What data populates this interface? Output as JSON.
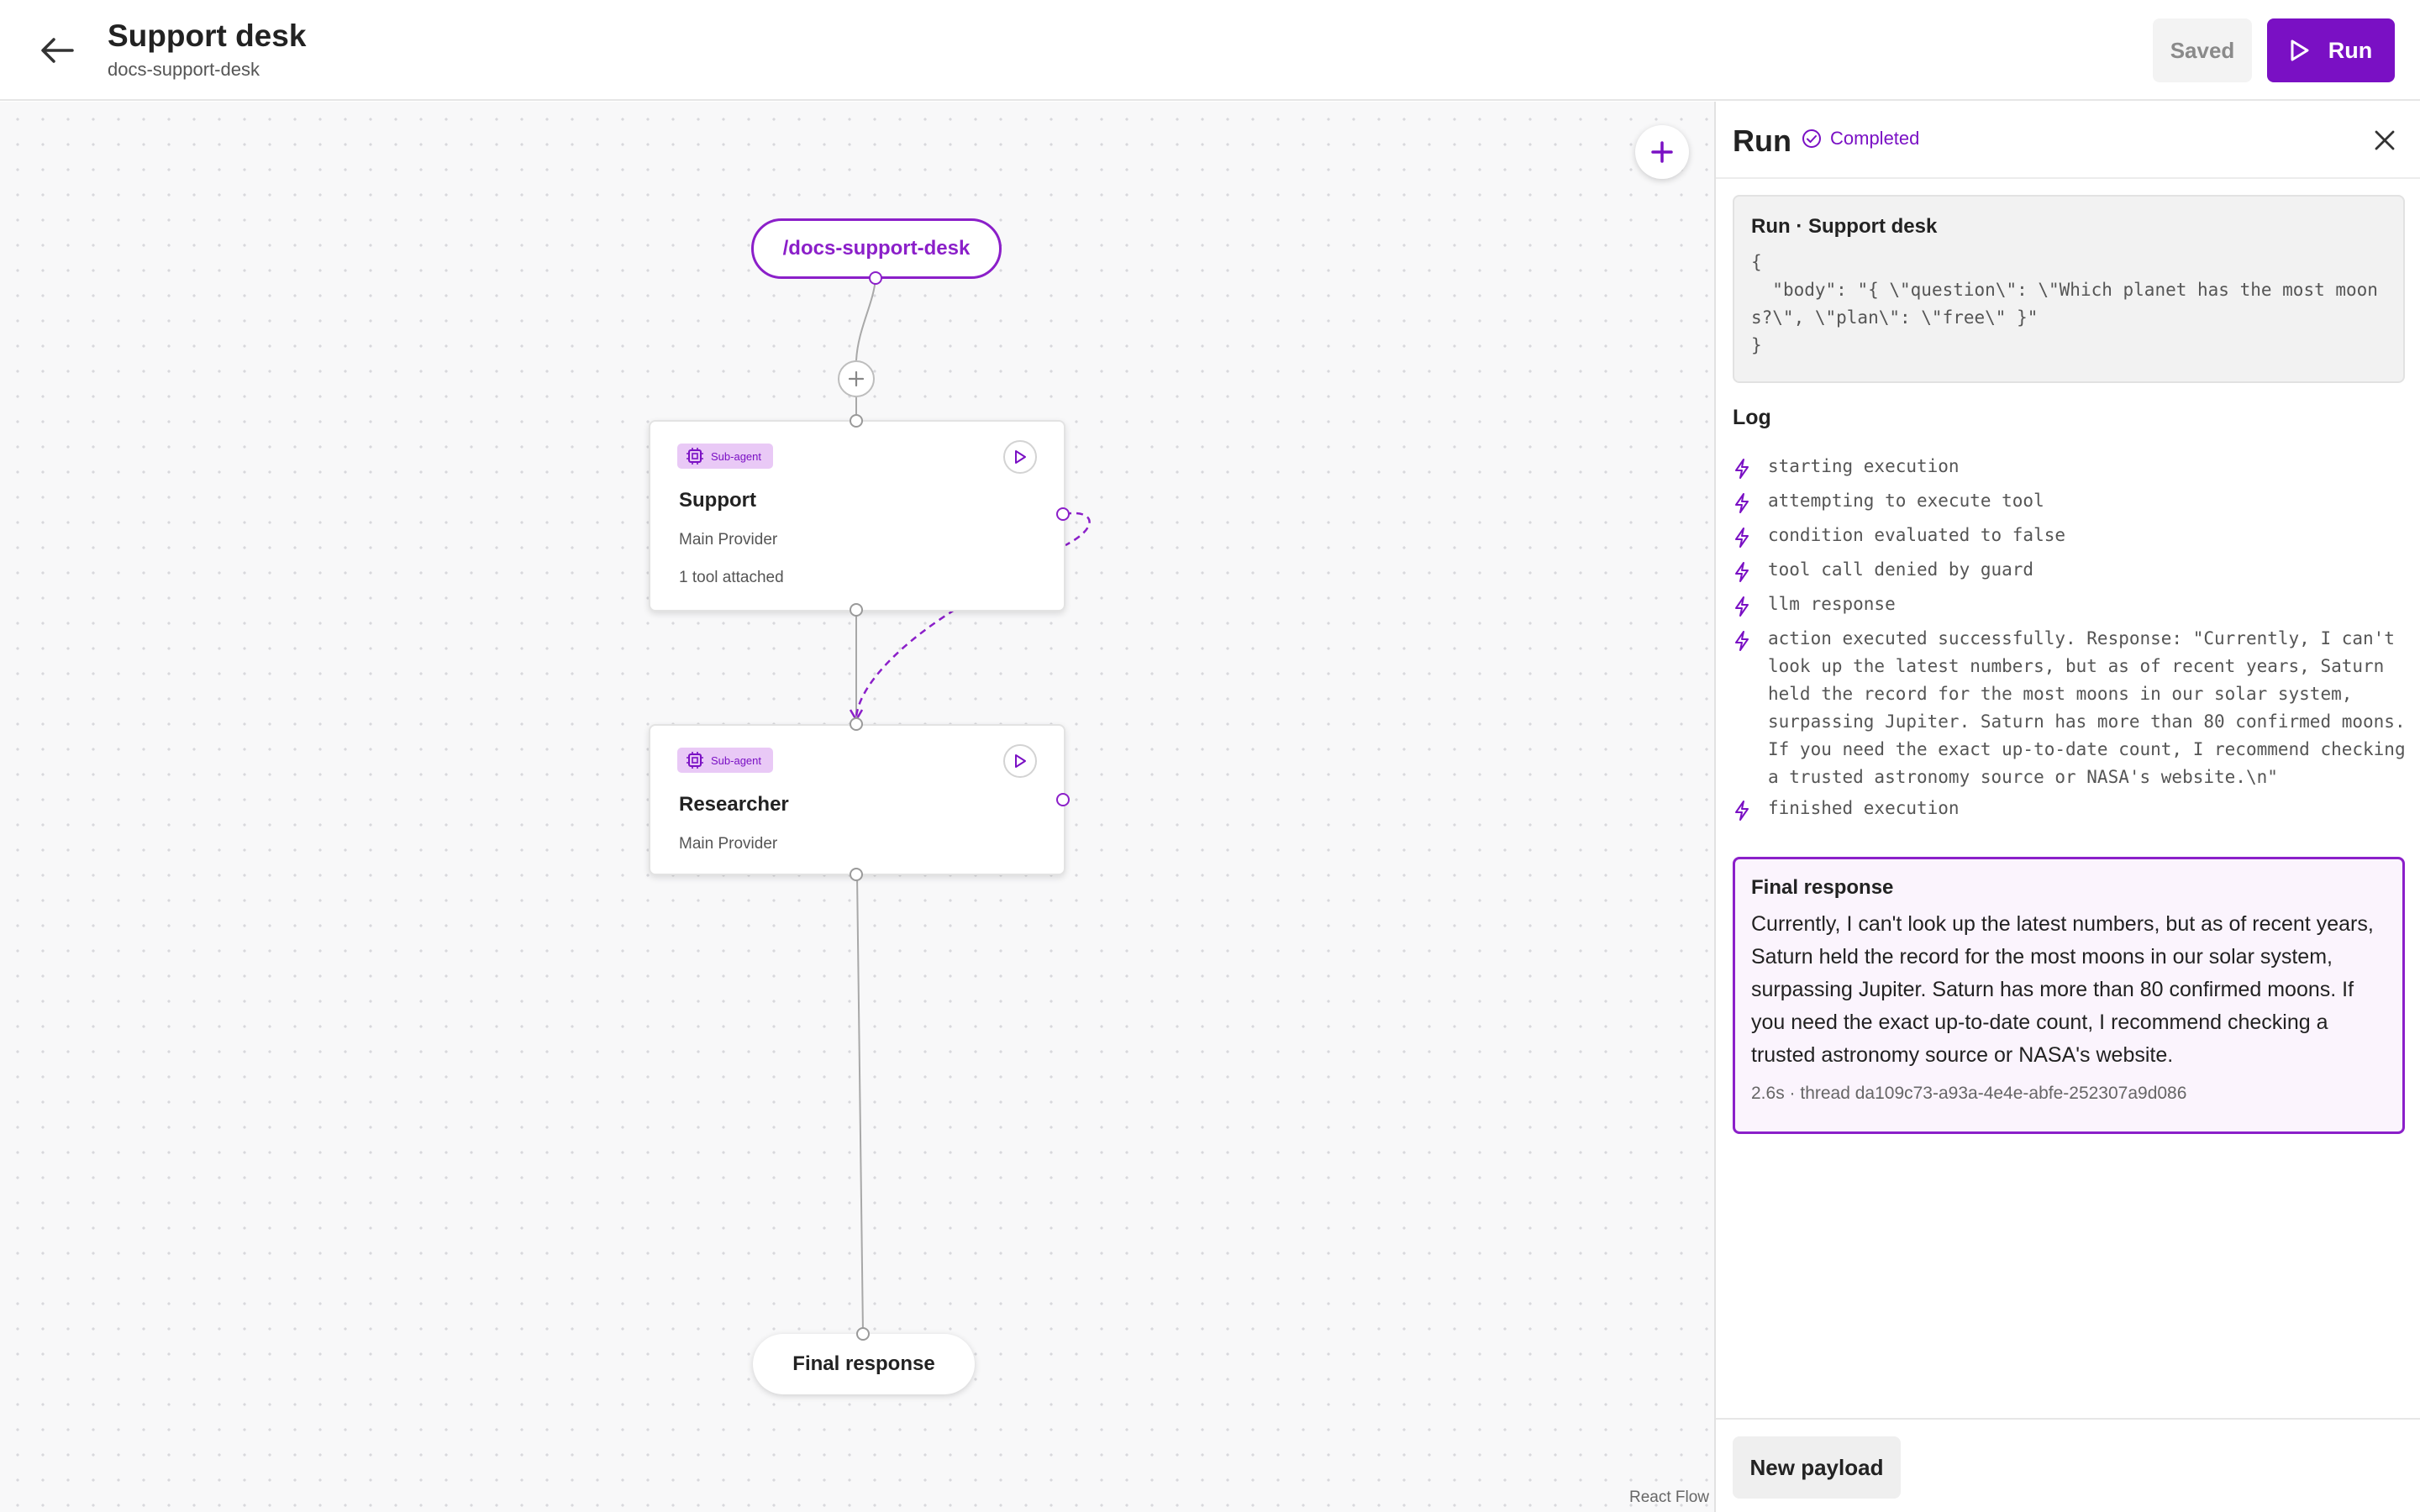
{
  "header": {
    "title": "Support desk",
    "subtitle": "docs-support-desk",
    "saved_label": "Saved",
    "run_label": "Run"
  },
  "colors": {
    "accent": "#7a10c4",
    "accent_light": "#e9c9f6",
    "canvas_bg": "#f8f8f9"
  },
  "canvas": {
    "trigger_label": "/docs-support-desk",
    "nodes": [
      {
        "badge": "Sub-agent",
        "title": "Support",
        "provider": "Main Provider",
        "tools": "1 tool attached"
      },
      {
        "badge": "Sub-agent",
        "title": "Researcher",
        "provider": "Main Provider"
      }
    ],
    "final_node_label": "Final response",
    "attribution": "React Flow"
  },
  "panel": {
    "title": "Run",
    "status": "Completed",
    "request_title": "Run · Support desk",
    "request_body": "{\n  \"body\": \"{ \\\"question\\\": \\\"Which planet has the most moons?\\\", \\\"plan\\\": \\\"free\\\" }\"\n}",
    "log_title": "Log",
    "log": [
      "starting execution",
      "attempting to execute tool",
      "condition evaluated to false",
      "tool call denied by guard",
      "llm response",
      "action executed successfully. Response: \"Currently, I can't look up the latest numbers, but as of recent years, Saturn held the record for the most moons in our solar system, surpassing Jupiter. Saturn has more than 80 confirmed moons. If you need the exact up-to-date count, I recommend checking a trusted astronomy source or NASA's website.\\n\"",
      "finished execution"
    ],
    "final_title": "Final response",
    "final_text": "Currently, I can't look up the latest numbers, but as of recent years, Saturn held the record for the most moons in our solar system, surpassing Jupiter. Saturn has more than 80 confirmed moons. If you need the exact up-to-date count, I recommend checking a trusted astronomy source or NASA's website.",
    "final_meta": "2.6s · thread da109c73-a93a-4e4e-abfe-252307a9d086",
    "new_payload_label": "New payload"
  }
}
